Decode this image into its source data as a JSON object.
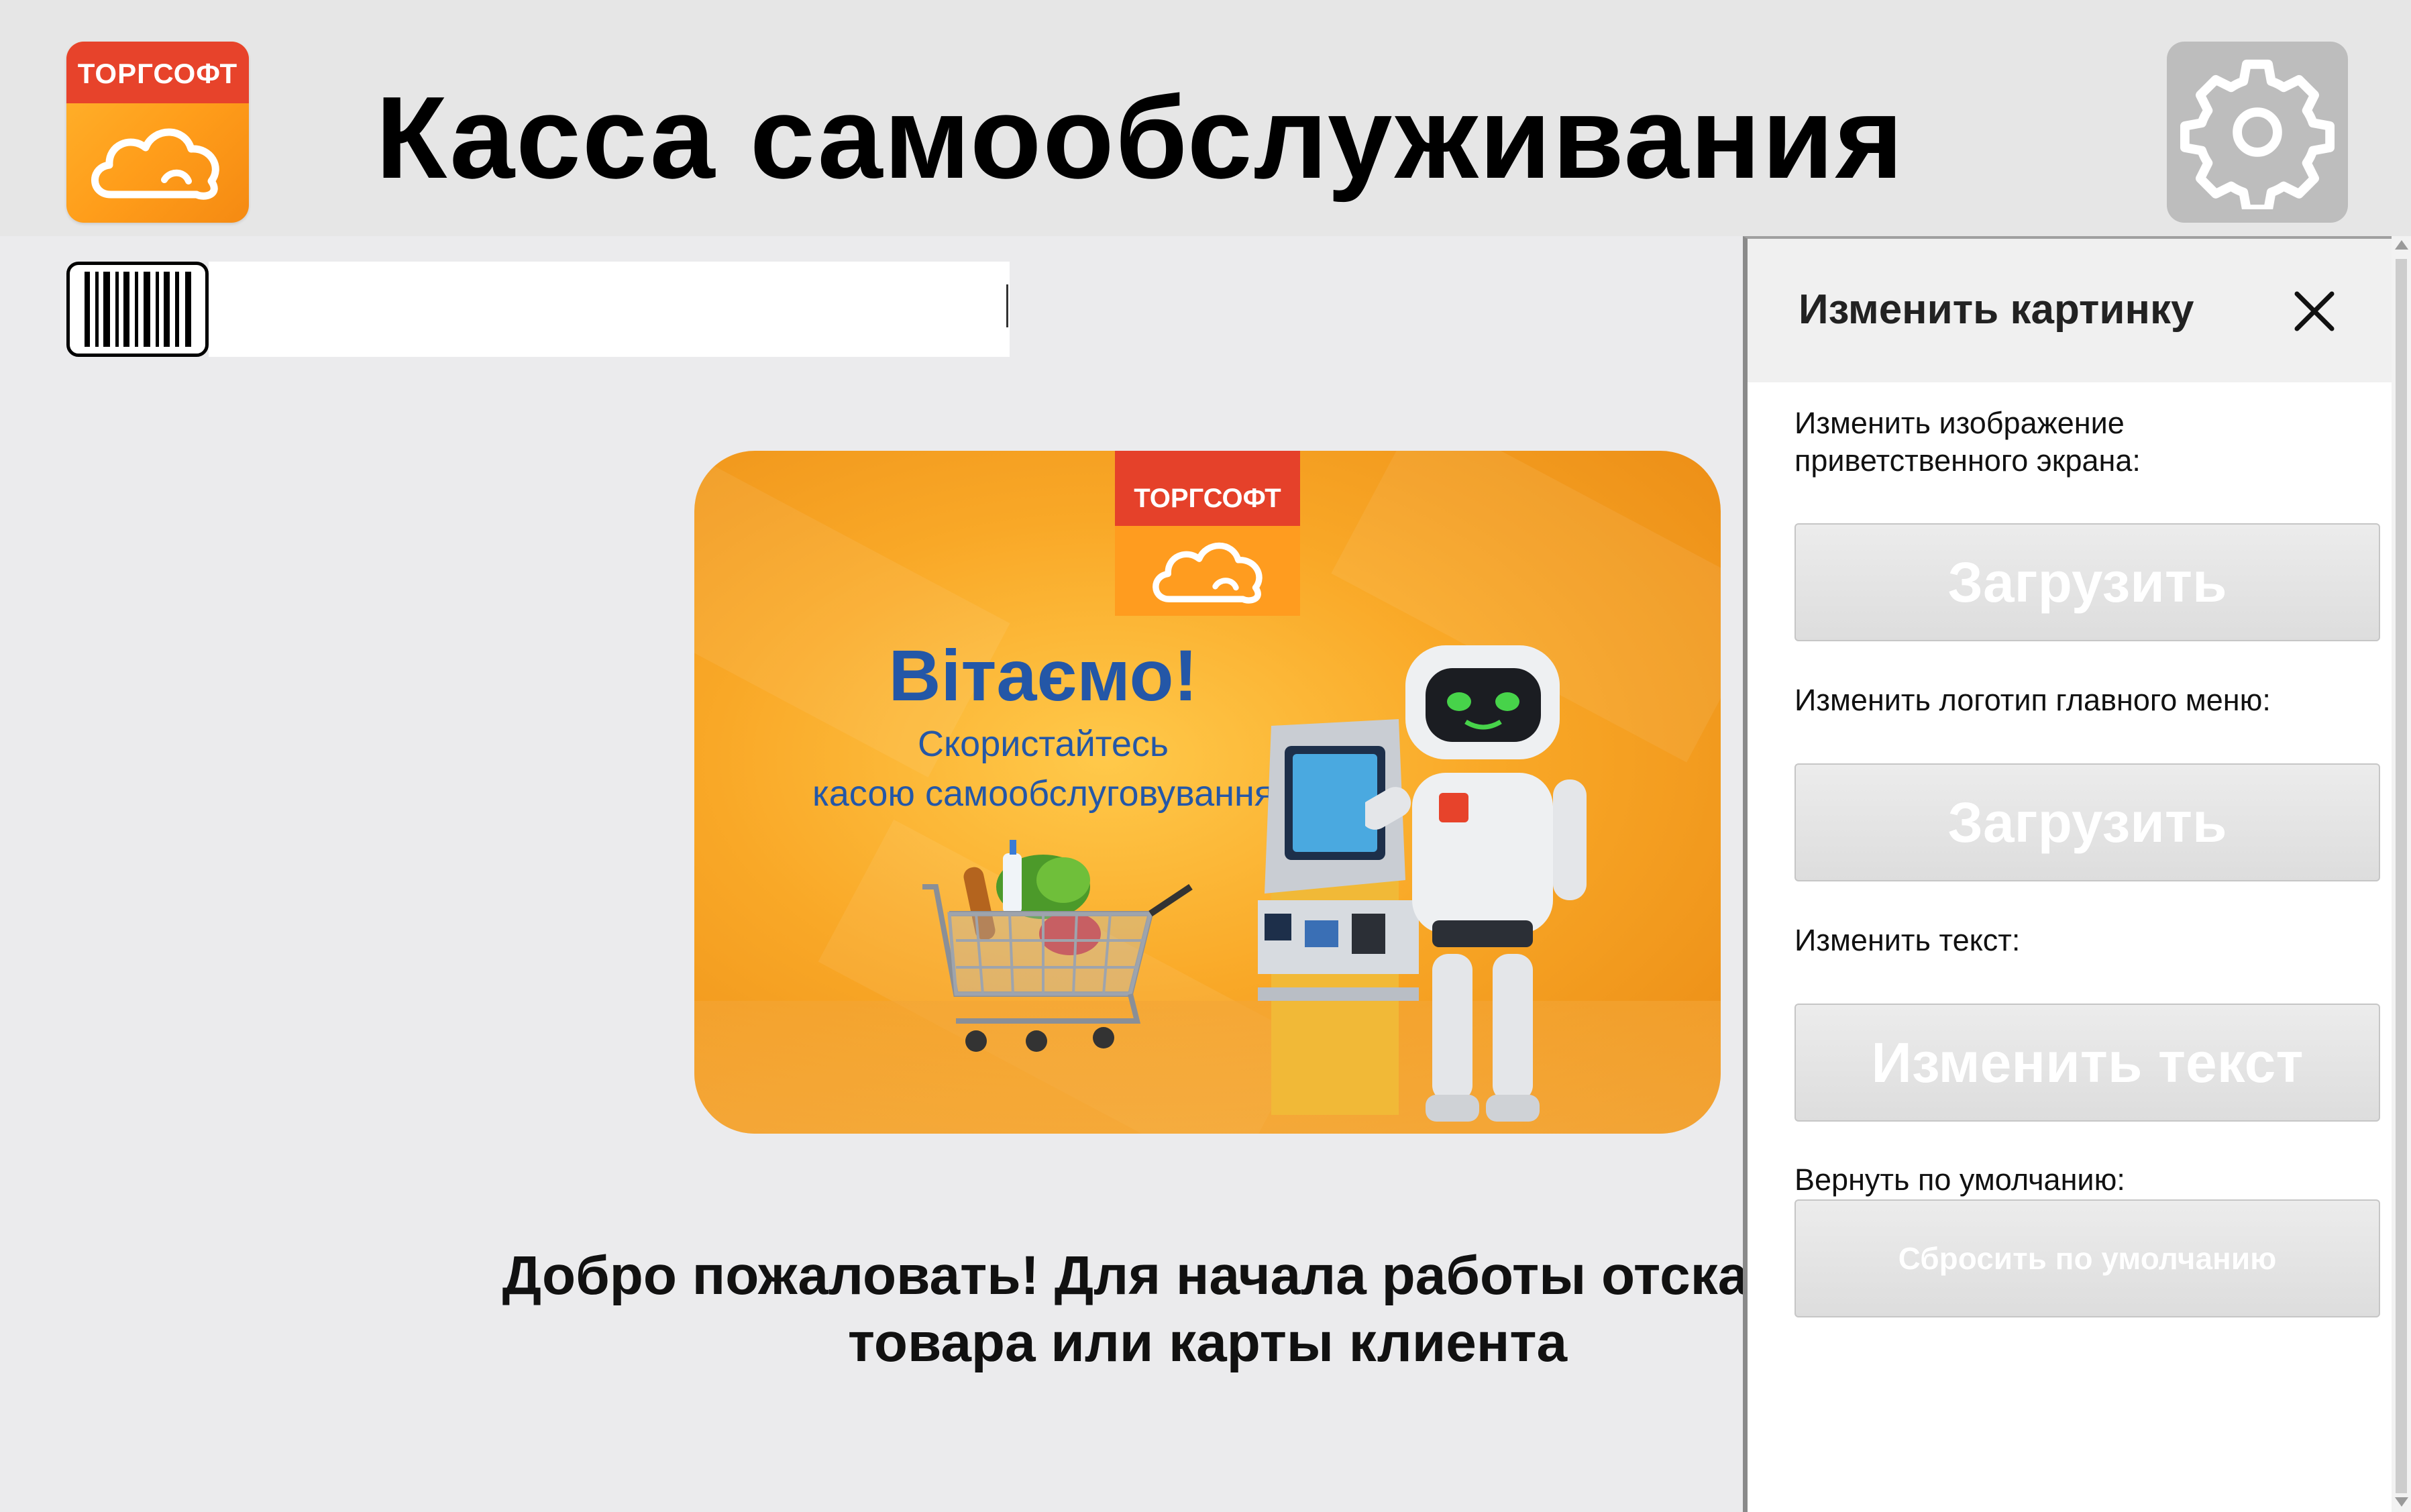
{
  "header": {
    "logo_text": "ТОРГСОФТ",
    "title": "Касса самообслуживания",
    "settings_icon": "gear-icon"
  },
  "scanner": {
    "icon": "barcode-icon",
    "value": ""
  },
  "banner": {
    "logo_text": "ТОРГСОФТ",
    "greeting": "Вітаємо!",
    "subtitle_line1": "Скористайтесь",
    "subtitle_line2": "касою самообслуговування"
  },
  "welcome": {
    "line1": "Добро пожаловать! Для начала работы отсканируй",
    "line2": "товара или карты клиента"
  },
  "panel": {
    "title": "Изменить картинку",
    "close_icon": "close-icon",
    "welcome_image_label": "Изменить изображение приветственного экрана:",
    "upload_welcome_button": "Загрузить",
    "menu_logo_label": "Изменить логотип главного меню:",
    "upload_logo_button": "Загрузить",
    "text_label": "Изменить текст:",
    "change_text_button": "Изменить текст",
    "reset_label": "Вернуть по умолчанию:",
    "reset_button": "Сбросить по умолчанию"
  },
  "colors": {
    "brand_orange": "#f9a827",
    "brand_red": "#e7432b",
    "banner_text_blue": "#2457a7",
    "settings_gray": "#bdbdbd"
  }
}
